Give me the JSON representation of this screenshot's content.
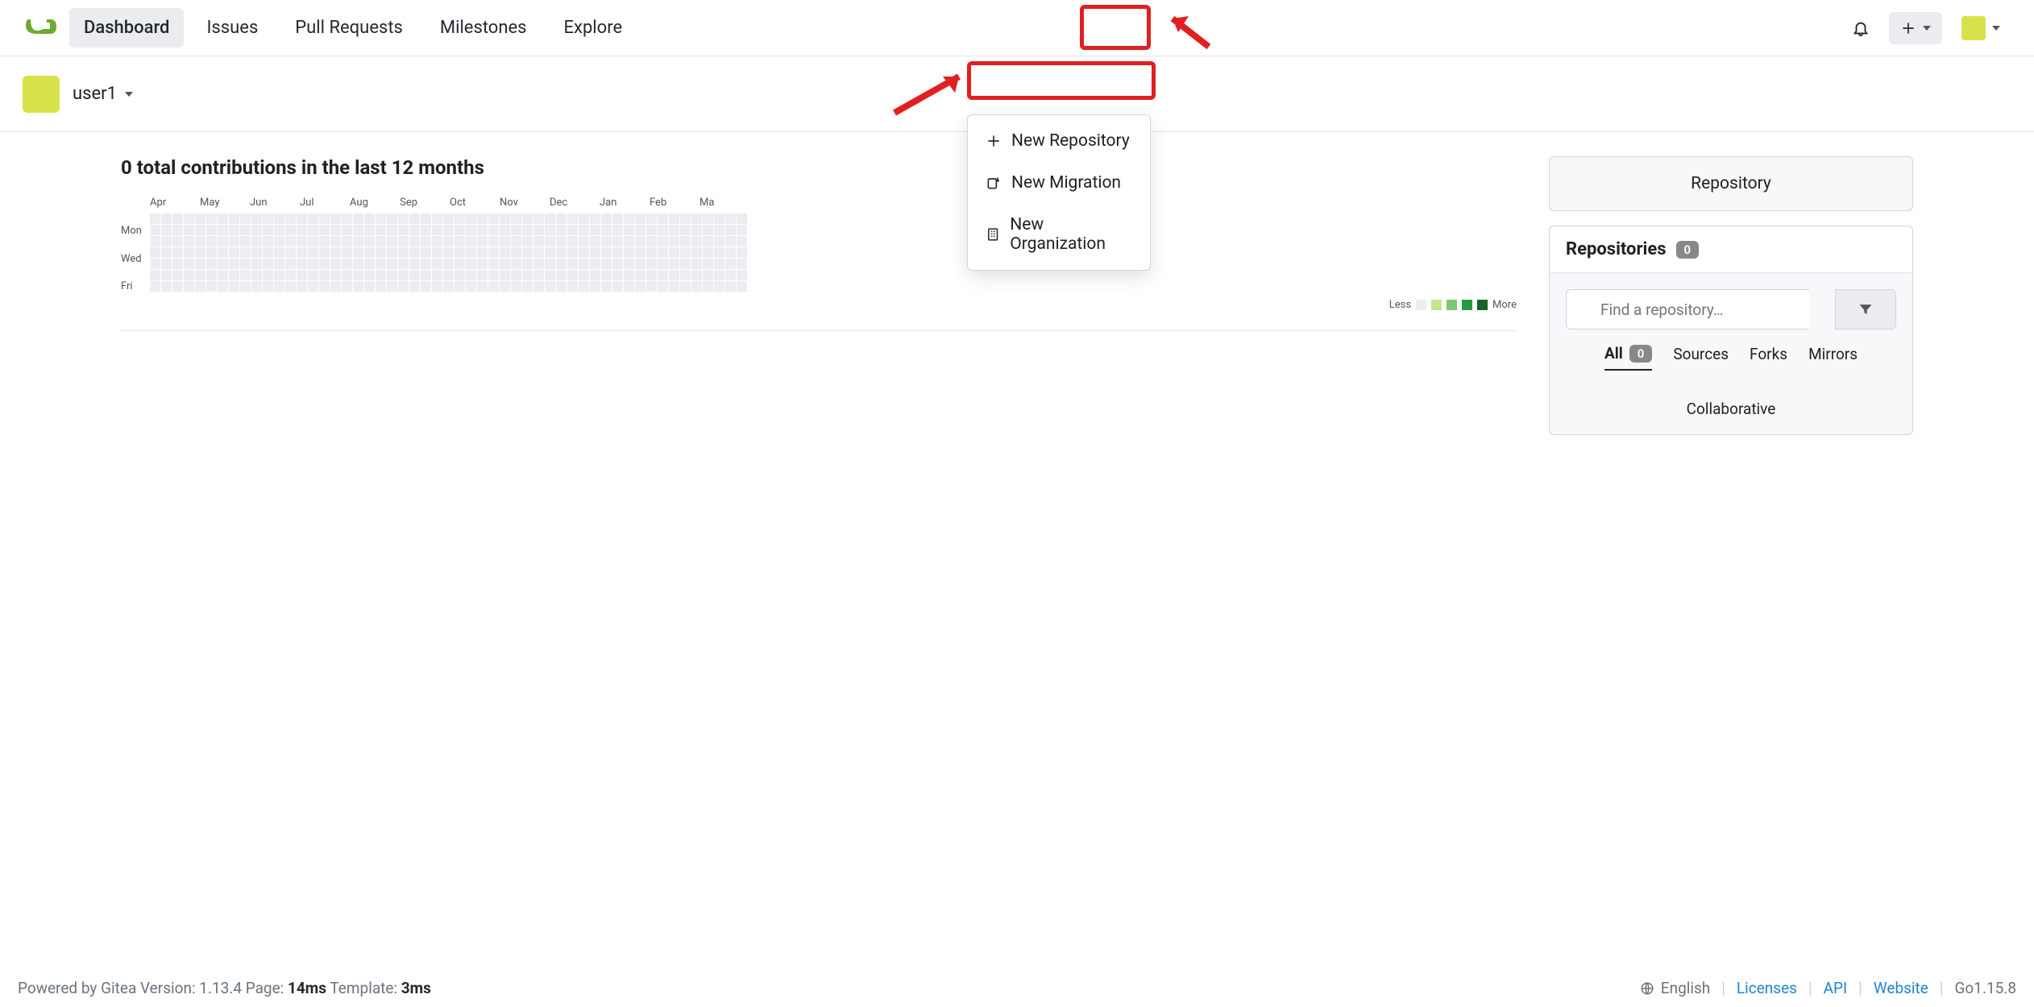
{
  "nav": {
    "dashboard": "Dashboard",
    "issues": "Issues",
    "pulls": "Pull Requests",
    "milestones": "Milestones",
    "explore": "Explore"
  },
  "user": {
    "name": "user1"
  },
  "dropdown": {
    "new_repo": "New Repository",
    "new_migration": "New Migration",
    "new_org": "New Organization"
  },
  "contrib": {
    "title": "0 total contributions in the last 12 months",
    "months": [
      "Apr",
      "May",
      "Jun",
      "Jul",
      "Aug",
      "Sep",
      "Oct",
      "Nov",
      "Dec",
      "Jan",
      "Feb",
      "Ma"
    ],
    "days": [
      "Mon",
      "Wed",
      "Fri"
    ],
    "legend_less": "Less",
    "legend_more": "More"
  },
  "right": {
    "repo_tab": "Repository",
    "repos_title": "Repositories",
    "repos_count": "0",
    "search_placeholder": "Find a repository…",
    "tabs": {
      "all": "All",
      "all_count": "0",
      "sources": "Sources",
      "forks": "Forks",
      "mirrors": "Mirrors",
      "collab": "Collaborative"
    }
  },
  "footer": {
    "text_pre": "Powered by Gitea Version: 1.13.4 Page: ",
    "page_time": "14ms",
    "template_label": " Template: ",
    "template_time": "3ms",
    "lang": "English",
    "licenses": "Licenses",
    "api": "API",
    "website": "Website",
    "go": "Go1.15.8"
  }
}
